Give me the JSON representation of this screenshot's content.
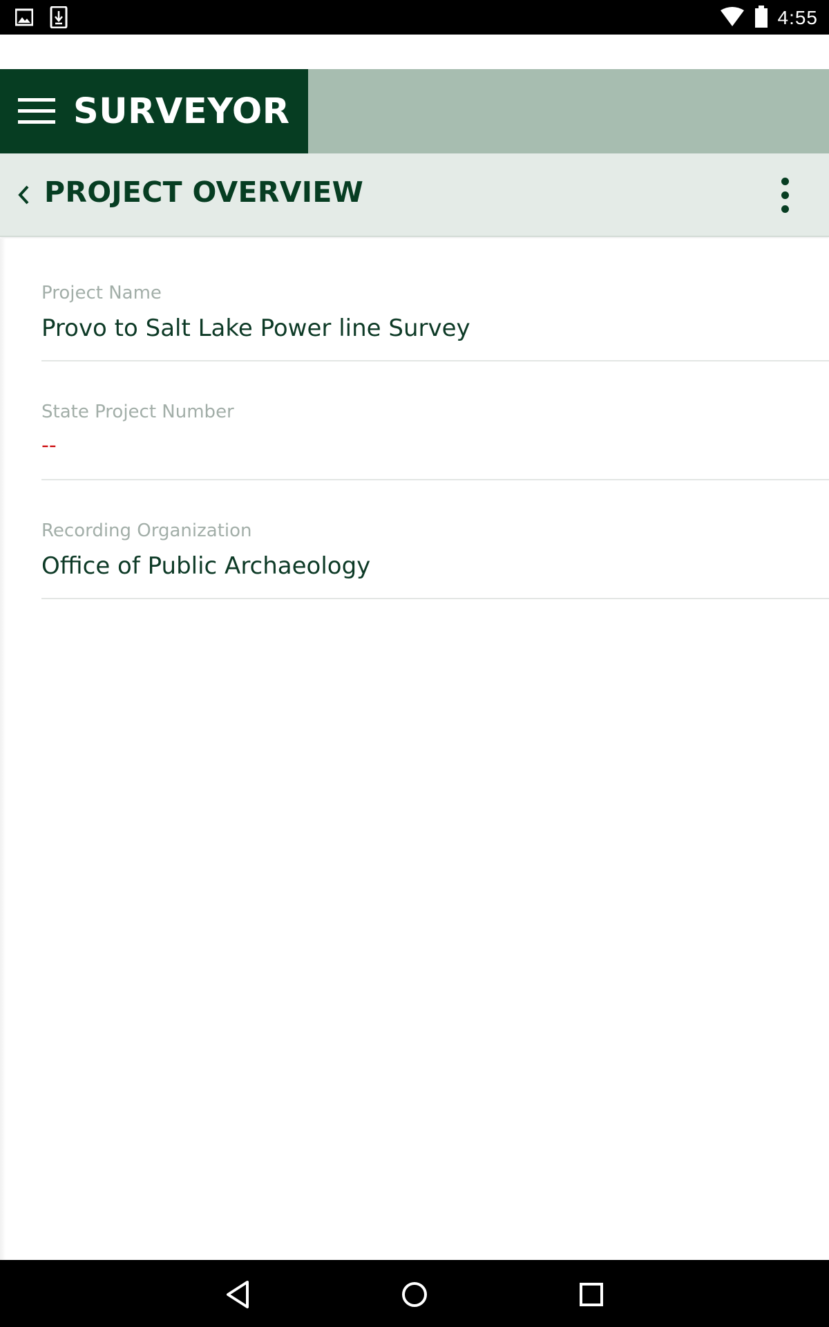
{
  "status_bar": {
    "time": "4:55",
    "icons": [
      "image-notification-icon",
      "download-notification-icon",
      "wifi-icon",
      "battery-icon"
    ]
  },
  "app_bar": {
    "title": "SURVEYOR",
    "menu_icon": "hamburger-menu-icon",
    "colors": {
      "brand": "#063d22",
      "accent_bar": "#a7bdb0"
    }
  },
  "sub_header": {
    "title": "PROJECT OVERVIEW",
    "back_icon": "chevron-left-icon",
    "overflow_icon": "more-vert-icon",
    "background": "#e4ebe7"
  },
  "fields": [
    {
      "label": "Project Name",
      "value": "Provo to Salt Lake Power line Survey"
    },
    {
      "label": "State Project Number",
      "value": "--"
    },
    {
      "label": "Recording Organization",
      "value": "Office of Public Archaeology"
    }
  ],
  "colors": {
    "empty_value": "#d0191b",
    "value_text": "#0d3a26",
    "label_text": "#a2aea8"
  },
  "nav_bar": {
    "icons": [
      "back-triangle-icon",
      "home-circle-icon",
      "recents-square-icon"
    ]
  }
}
